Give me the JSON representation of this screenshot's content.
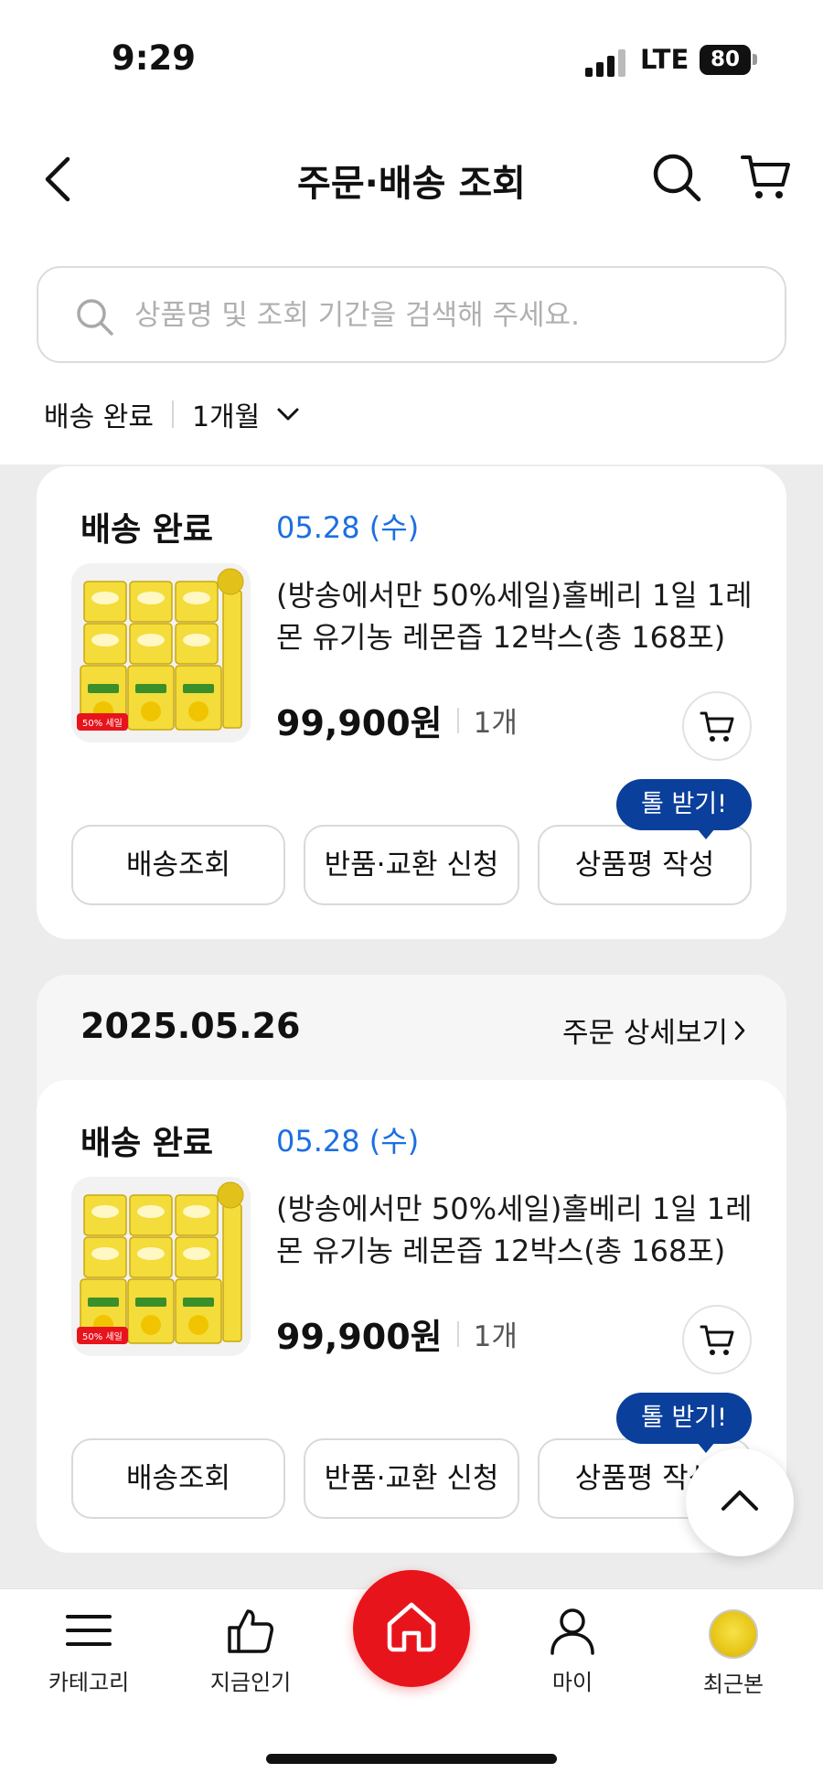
{
  "status_bar": {
    "time": "9:29",
    "network": "LTE",
    "battery": "80"
  },
  "header": {
    "title": "주문·배송 조회",
    "icons": [
      "back-icon",
      "search-icon",
      "cart-icon"
    ]
  },
  "search": {
    "placeholder": "상품명 및 조회 기간을 검색해 주세요."
  },
  "filter": {
    "status": "배송 완료",
    "period": "1개월"
  },
  "orders": [
    {
      "status": "배송 완료",
      "delivery_date": "05.28 (수)",
      "product_name": "(방송에서만 50%세일)홀베리 1일 1레몬 유기농 레몬즙 12박스(총 168포)",
      "thumb_badge": "50% 세일",
      "price": "99,900원",
      "quantity": "1개",
      "tooltip": "톨 받기!",
      "buttons": [
        "배송조회",
        "반품·교환 신청",
        "상품평 작성"
      ]
    },
    {
      "order_date": "2025.05.26",
      "detail_link": "주문 상세보기",
      "status": "배송 완료",
      "delivery_date": "05.28 (수)",
      "product_name": "(방송에서만 50%세일)홀베리 1일 1레몬 유기농 레몬즙 12박스(총 168포)",
      "thumb_badge": "50% 세일",
      "price": "99,900원",
      "quantity": "1개",
      "tooltip": "톨 받기!",
      "buttons": [
        "배송조회",
        "반품·교환 신청",
        "상품평 작성"
      ]
    }
  ],
  "tabbar": {
    "items": [
      {
        "label": "카테고리",
        "icon": "menu-icon"
      },
      {
        "label": "지금인기",
        "icon": "thumbs-up-icon"
      },
      {
        "label": "",
        "icon": "home-icon"
      },
      {
        "label": "마이",
        "icon": "person-icon"
      },
      {
        "label": "최근본",
        "icon": "recent-product-thumb"
      }
    ]
  },
  "colors": {
    "accent_blue": "#1c6fe0",
    "tooltip_blue": "#0a3f9c",
    "home_red": "#e8141c"
  }
}
